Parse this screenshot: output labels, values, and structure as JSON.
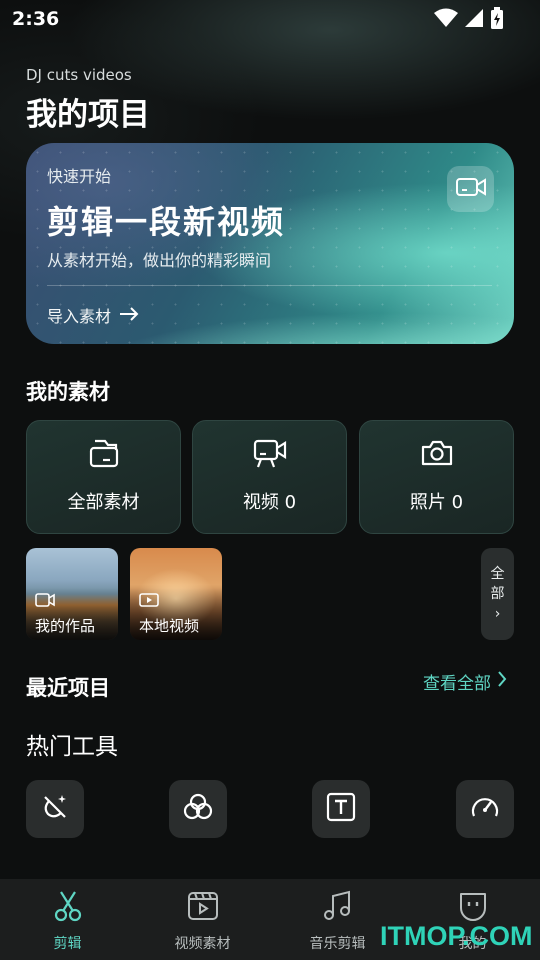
{
  "status_bar": {
    "time": "2:36"
  },
  "header": {
    "app_name": "DJ cuts videos",
    "title": "我的项目"
  },
  "hero": {
    "subtitle": "快速开始",
    "title": "剪辑一段新视频",
    "description": "从素材开始，做出你的精彩瞬间",
    "import_label": "导入素材",
    "icon": "video-camera-icon"
  },
  "materials": {
    "title": "我的素材",
    "cards": [
      {
        "label": "全部素材",
        "icon": "folder-icon"
      },
      {
        "label": "视频 0",
        "icon": "video-camera-icon"
      },
      {
        "label": "照片 0",
        "icon": "camera-icon"
      }
    ],
    "thumbs": [
      {
        "label": "我的作品",
        "icon": "video-camera-icon"
      },
      {
        "label": "本地视频",
        "icon": "play-icon"
      }
    ],
    "all_label": "全部"
  },
  "recent": {
    "title": "最近项目",
    "see_all": "查看全部"
  },
  "tools": {
    "title": "热门工具",
    "items": [
      {
        "icon": "magic-brush-icon"
      },
      {
        "icon": "filter-icon"
      },
      {
        "icon": "text-icon"
      },
      {
        "icon": "speed-icon"
      }
    ]
  },
  "nav": {
    "items": [
      {
        "label": "剪辑",
        "icon": "scissors-icon",
        "active": true
      },
      {
        "label": "视频素材",
        "icon": "video-material-icon"
      },
      {
        "label": "音乐剪辑",
        "icon": "music-icon"
      },
      {
        "label": "我的",
        "icon": "profile-icon"
      }
    ]
  },
  "watermark": "ITMOP.COM",
  "colors": {
    "accent": "#5fd6c4",
    "background": "#0d0f0f",
    "card": "#1f2f2c"
  }
}
